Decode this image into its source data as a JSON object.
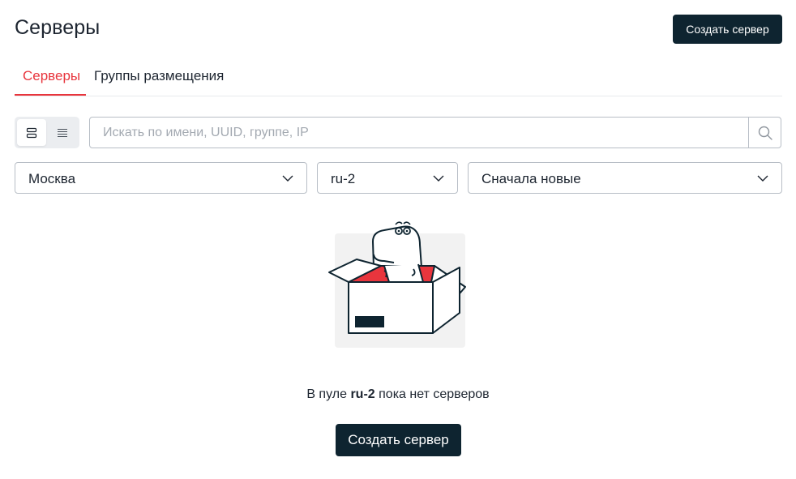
{
  "header": {
    "title": "Серверы",
    "create_button": "Создать сервер"
  },
  "tabs": [
    {
      "label": "Серверы",
      "active": true
    },
    {
      "label": "Группы размещения",
      "active": false
    }
  ],
  "view_toggle": {
    "options": [
      "cards-view-icon",
      "list-view-icon"
    ],
    "selected": "cards-view-icon"
  },
  "search": {
    "placeholder": "Искать по имени, UUID, группе, IP",
    "value": ""
  },
  "filters": {
    "region": "Москва",
    "pool": "ru-2",
    "sort": "Сначала новые"
  },
  "empty_state": {
    "prefix": "В пуле",
    "pool": "ru-2",
    "suffix": "пока нет серверов",
    "button": "Создать сервер",
    "illustration": "dinosaur-in-box-illustration"
  },
  "colors": {
    "accent": "#e8353d",
    "button_dark": "#0e2430",
    "border": "#b8bec6",
    "text": "#1d2530"
  }
}
